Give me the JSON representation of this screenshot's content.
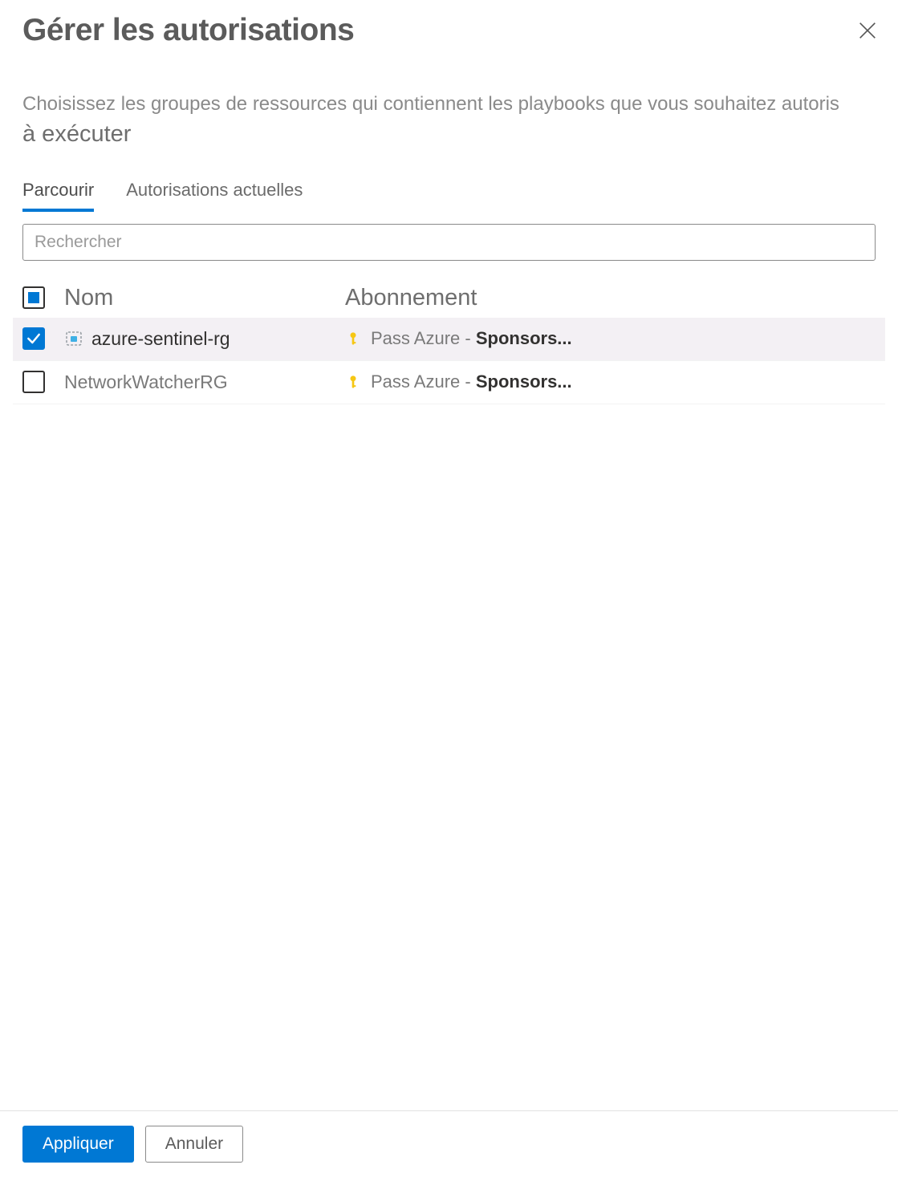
{
  "header": {
    "title": "Gérer les autorisations"
  },
  "description": {
    "line1": "Choisissez les groupes de ressources qui contiennent les playbooks que vous souhaitez autoris",
    "line2": "à exécuter"
  },
  "tabs": {
    "browse": "Parcourir",
    "current": "Autorisations actuelles",
    "active": "browse"
  },
  "search": {
    "placeholder": "Rechercher",
    "value": ""
  },
  "table": {
    "headers": {
      "name": "Nom",
      "subscription": "Abonnement"
    },
    "rows": [
      {
        "checked": true,
        "name": "azure-sentinel-rg",
        "hasRgIcon": true,
        "sub_prefix": "Pass Azure - ",
        "sub_strong": "Sponsors..."
      },
      {
        "checked": false,
        "name": "NetworkWatcherRG",
        "hasRgIcon": false,
        "sub_prefix": "Pass Azure - ",
        "sub_strong": "Sponsors..."
      }
    ]
  },
  "footer": {
    "apply": "Appliquer",
    "cancel": "Annuler"
  },
  "icons": {
    "close": "close-icon",
    "key": "key-icon",
    "resourceGroup": "resource-group-icon",
    "check": "check-icon"
  }
}
